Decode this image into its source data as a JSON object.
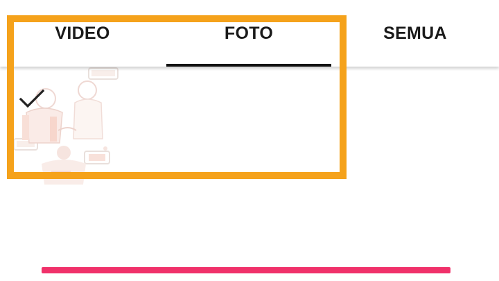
{
  "tabs": [
    {
      "label": "VIDEO",
      "selected": false
    },
    {
      "label": "FOTO",
      "selected": true
    },
    {
      "label": "SEMUA",
      "selected": false
    }
  ],
  "content": {
    "thumbnail_icon": "cartoon-illustration-thumbnail",
    "check_icon": "check-icon",
    "thumbnail_selected": true
  },
  "highlight": {
    "color": "#F5A21B"
  },
  "progress_bar": {
    "color": "#F0316A"
  },
  "colors": {
    "tab_text": "#1a1a1a",
    "indicator": "#111111",
    "background": "#ffffff"
  }
}
